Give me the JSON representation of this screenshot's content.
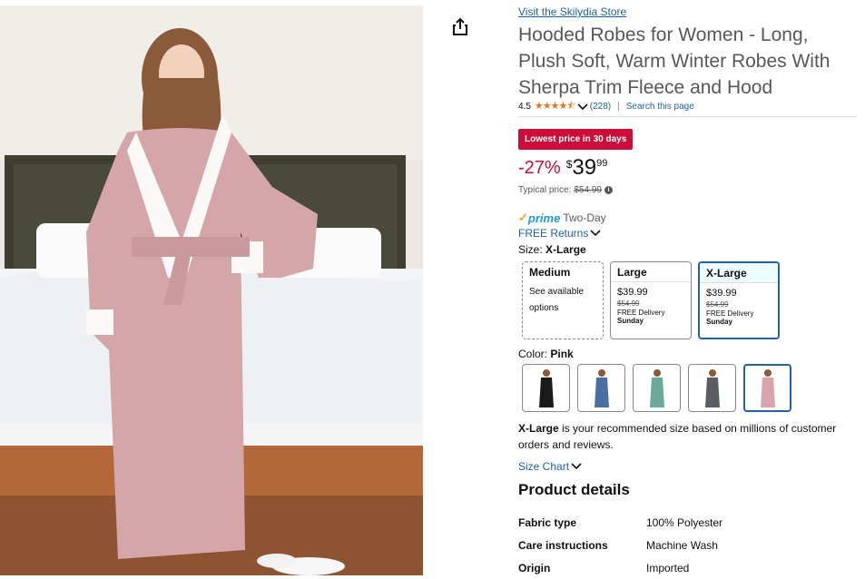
{
  "store_link": "Visit the Skilydia Store",
  "product_title": "Hooded Robes for Women - Long, Plush Soft, Warm Winter Robes With Sherpa Trim Fleece and Hood",
  "rating": {
    "value": "4.5",
    "stars": "★★★★⯪",
    "count": "(228)",
    "search_link": "Search this page"
  },
  "deal_badge": "Lowest price in 30 days",
  "price": {
    "discount": "-27%",
    "symbol": "$",
    "whole": "39",
    "fraction": "99",
    "typical_label": "Typical price:",
    "typical_value": "$54.99",
    "info_icon": "i"
  },
  "delivery": {
    "prime_check": "✓",
    "prime_word": "prime",
    "prime_speed": "Two-Day",
    "free_returns": "FREE Returns"
  },
  "size": {
    "label": "Size:",
    "selected": "X-Large",
    "options": [
      {
        "name": "Medium",
        "note": "See available options"
      },
      {
        "name": "Large",
        "price": "$39.99",
        "list_price": "$54.99",
        "delivery": "FREE Delivery",
        "day": "Sunday"
      },
      {
        "name": "X-Large",
        "price": "$39.99",
        "list_price": "$54.99",
        "delivery": "FREE Delivery",
        "day": "Sunday"
      }
    ]
  },
  "color": {
    "label": "Color:",
    "selected": "Pink",
    "swatch_colors": [
      "#1a1a1a",
      "#4a6fa5",
      "#6ba99a",
      "#5a5d66",
      "#d9a3ad"
    ]
  },
  "recommendation": {
    "size": "X-Large",
    "text": " is your recommended size based on millions of customer orders and reviews."
  },
  "size_chart_link": "Size Chart",
  "product_details": {
    "title": "Product details",
    "rows": [
      {
        "key": "Fabric type",
        "value": "100% Polyester"
      },
      {
        "key": "Care instructions",
        "value": "Machine Wash"
      },
      {
        "key": "Origin",
        "value": "Imported"
      }
    ]
  },
  "colors": {
    "accent_link": "#2162a1",
    "deal_red": "#cc0c39",
    "star_orange": "#de7921",
    "selected_border": "#2162a1"
  },
  "icons": [
    "share-icon",
    "chevron-down-icon",
    "info-icon",
    "prime-check-icon"
  ]
}
